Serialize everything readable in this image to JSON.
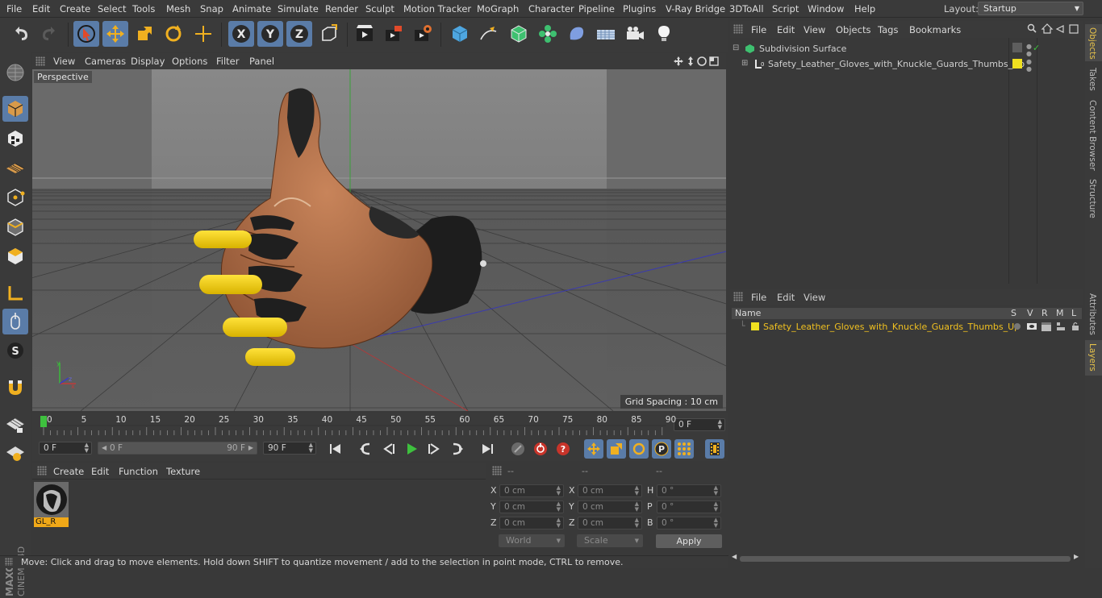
{
  "menubar": {
    "items": [
      "File",
      "Edit",
      "Create",
      "Select",
      "Tools",
      "Mesh",
      "Snap",
      "Animate",
      "Simulate",
      "Render",
      "Sculpt",
      "Motion Tracker",
      "MoGraph",
      "Character",
      "Pipeline",
      "Plugins",
      "V-Ray Bridge",
      "3DToAll",
      "Script",
      "Window",
      "Help"
    ],
    "layout_label": "Layout:",
    "layout_value": "Startup"
  },
  "toolbar": {
    "icons": [
      "undo-icon",
      "redo-icon",
      "select-cursor-icon",
      "move-icon",
      "scale-icon",
      "rotate-icon",
      "transform-icon",
      "x-axis-icon",
      "y-axis-icon",
      "z-axis-icon",
      "coordinate-system-icon",
      "render-view-icon",
      "render-picture-viewer-icon",
      "render-settings-icon",
      "cube-primitive-icon",
      "pen-spline-icon",
      "subdivision-nurbs-icon",
      "cloner-icon",
      "deformer-icon",
      "floor-icon",
      "camera-icon",
      "light-icon"
    ]
  },
  "viewport": {
    "menu": [
      "View",
      "Cameras",
      "Display",
      "Options",
      "Filter",
      "Panel"
    ],
    "view_name": "Perspective",
    "grid_spacing": "Grid Spacing : 10 cm"
  },
  "timeline": {
    "ticks": [
      "0",
      "5",
      "10",
      "15",
      "20",
      "25",
      "30",
      "35",
      "40",
      "45",
      "50",
      "55",
      "60",
      "65",
      "70",
      "75",
      "80",
      "85",
      "90"
    ],
    "current_frame": "0 F"
  },
  "playbar": {
    "start_frame": "0 F",
    "range_start": "0 F",
    "range_end": "90 F",
    "end_frame": "90 F"
  },
  "material_panel": {
    "menu": [
      "Create",
      "Edit",
      "Function",
      "Texture"
    ],
    "material_name": "GL_R"
  },
  "coords": {
    "headers": [
      "--",
      "--",
      "--"
    ],
    "rows": [
      {
        "l1": "X",
        "v1": "0 cm",
        "l2": "X",
        "v2": "0 cm",
        "l3": "H",
        "v3": "0 °"
      },
      {
        "l1": "Y",
        "v1": "0 cm",
        "l2": "Y",
        "v2": "0 cm",
        "l3": "P",
        "v3": "0 °"
      },
      {
        "l1": "Z",
        "v1": "0 cm",
        "l2": "Z",
        "v2": "0 cm",
        "l3": "B",
        "v3": "0 °"
      }
    ],
    "mode1": "World",
    "mode2": "Scale",
    "apply": "Apply"
  },
  "status": "Move: Click and drag to move elements. Hold down SHIFT to quantize movement / add to the selection in point mode, CTRL to remove.",
  "objects_panel": {
    "menu": [
      "File",
      "Edit",
      "View",
      "Objects",
      "Tags",
      "Bookmarks"
    ],
    "items": [
      {
        "name": "Subdivision Surface",
        "color": "#cfcfcf"
      },
      {
        "name": "Safety_Leather_Gloves_with_Knuckle_Guards_Thumbs_Up",
        "color": "#cfcfcf"
      }
    ]
  },
  "layers_panel": {
    "menu": [
      "File",
      "Edit",
      "View"
    ],
    "columns": [
      "Name",
      "S",
      "V",
      "R",
      "M",
      "L"
    ],
    "layer_name": "Safety_Leather_Gloves_with_Knuckle_Guards_Thumbs_Up",
    "layer_color": "#f0c020"
  },
  "right_tabs": [
    "Objects",
    "Takes",
    "Content Browser",
    "Structure",
    "Attributes",
    "Layers"
  ],
  "colors": {
    "accent": "#5a7ca8",
    "highlight": "#f0c020",
    "panel": "#393939"
  }
}
